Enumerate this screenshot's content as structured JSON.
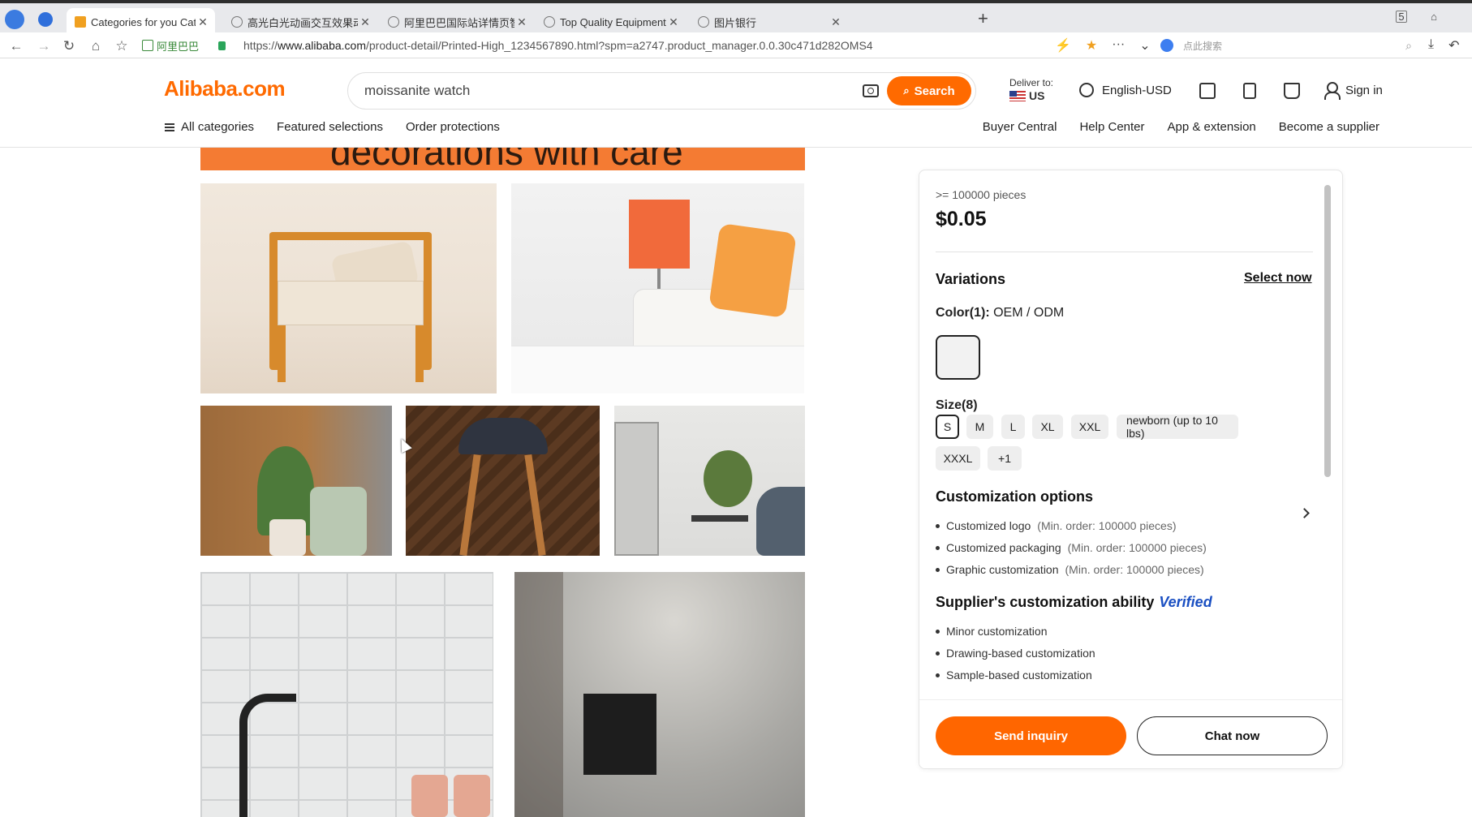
{
  "browser": {
    "tabs": [
      {
        "title": "Categories for you Categor",
        "active": true
      },
      {
        "title": "高光白光动画交互效果动画白",
        "active": false
      },
      {
        "title": "阿里巴巴国际站详情页智能版",
        "active": false
      },
      {
        "title": "Top Quality Equipment Indo",
        "active": false
      },
      {
        "title": "图片银行",
        "active": false
      }
    ],
    "site_label": "阿里巴巴",
    "url_prefix": "https://",
    "url_domain": "www.alibaba.com",
    "url_path": "/product-detail/Printed-High_1234567890.html?spm=a2747.product_manager.0.0.30c471d282OMS4",
    "search_placeholder": "点此搜索",
    "tab_count_badge": "5"
  },
  "header": {
    "logo": "Alibaba.com",
    "search_query": "moissanite watch",
    "search_button": "Search",
    "deliver_label": "Deliver to:",
    "deliver_country": "US",
    "language": "English-USD",
    "sign_in": "Sign in",
    "nav_left": [
      "All categories",
      "Featured selections",
      "Order protections"
    ],
    "nav_right": [
      "Buyer Central",
      "Help Center",
      "App & extension",
      "Become a supplier"
    ]
  },
  "content": {
    "banner_text": "decorations with care"
  },
  "panel": {
    "min_order": ">= 100000 pieces",
    "price": "$0.05",
    "variations_title": "Variations",
    "select_now": "Select now",
    "color_label": "Color(1):",
    "color_value": "OEM / ODM",
    "size_label": "Size(8)",
    "sizes": [
      "S",
      "M",
      "L",
      "XL",
      "XXL",
      "newborn (up to 10 lbs)",
      "XXXL",
      "+1"
    ],
    "customization_title": "Customization options",
    "customization_items": [
      {
        "name": "Customized logo",
        "note": "(Min. order: 100000 pieces)"
      },
      {
        "name": "Customized packaging",
        "note": "(Min. order: 100000 pieces)"
      },
      {
        "name": "Graphic customization",
        "note": "(Min. order: 100000 pieces)"
      }
    ],
    "supplier_title": "Supplier's customization ability",
    "verified": "Verified",
    "supplier_items": [
      "Minor customization",
      "Drawing-based customization",
      "Sample-based customization"
    ],
    "send_inquiry": "Send inquiry",
    "chat_now": "Chat now"
  },
  "colors": {
    "brand_orange": "#ff6a00",
    "verified_blue": "#1a4fc2"
  }
}
